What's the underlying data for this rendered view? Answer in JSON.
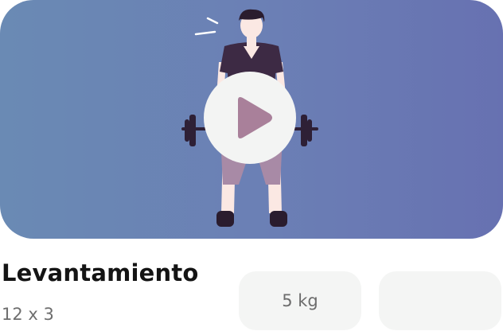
{
  "exercise": {
    "title": "Levantamiento",
    "reps": "12 x 3",
    "weight": "5 kg",
    "second_chip": ""
  },
  "media": {
    "illustration": "man-lifting-barbell",
    "play_icon": "play-icon"
  },
  "colors": {
    "gradient_start": "#6a8ab4",
    "gradient_end": "#6771b1",
    "play_button_bg": "#f3f4f3",
    "play_triangle": "#a9809a",
    "chip_bg": "#f4f5f4"
  }
}
